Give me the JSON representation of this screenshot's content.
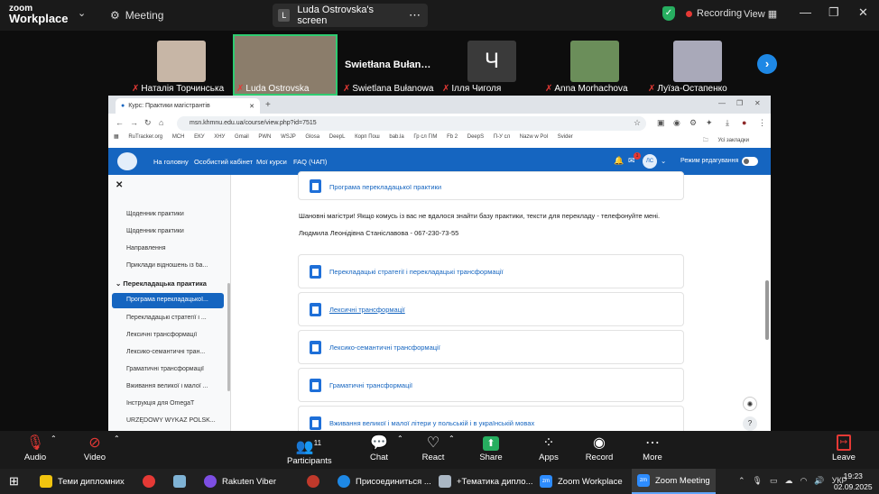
{
  "zoom": {
    "logo_line1": "zoom",
    "logo_line2": "Workplace",
    "meeting_label": "Meeting",
    "screen_initial": "L",
    "screen_label": "Luda Ostrovska's screen",
    "recording_label": "Recording",
    "view_label": "View",
    "colors": {
      "active_border": "#2ecc71",
      "record_dot": "#e53935",
      "shield": "#27ae60"
    }
  },
  "participants": [
    {
      "name": "Наталія Торчинська",
      "thumb_color": "#c7b6a6"
    },
    {
      "name": "Luda Ostrovska",
      "thumb_color": "#8b7d6b",
      "active": true
    },
    {
      "name": "Swietlana Bułanowa",
      "big_label": "Swietłana Bułan…"
    },
    {
      "name": "Ілля Чиголя",
      "initial": "Ч"
    },
    {
      "name": "Anna Morhachova",
      "thumb_color": "#6b8e5a"
    },
    {
      "name": "Луїза-Остапенко",
      "thumb_color": "#a9a9b9"
    }
  ],
  "browser": {
    "tab_title": "Курс: Практики магістрантів",
    "url": "msn.khmnu.edu.ua/course/view.php?id=7515",
    "bookmarks": [
      "RuTracker.org",
      "МСН",
      "ЕКУ",
      "ХНУ",
      "Gmail",
      "PWN",
      "WSJP",
      "Glosa",
      "DeepL",
      "Корп Пош",
      "bab.la",
      "Гр сл ГІМ",
      "Fb 2",
      "DeepS",
      "П-У сл",
      "Nazw w Pol",
      "Svider"
    ],
    "bookmarks_all": "Усі закладки",
    "nav": [
      "На головну",
      "Особистий кабінет",
      "Мої курси",
      "FAQ (ЧАП)"
    ],
    "user_initials": "ЛС",
    "edit_mode_label": "Режим редагування",
    "notification_count": "1"
  },
  "sidebar": {
    "items_top": [
      "Щоденник практики",
      "Щоденник практики",
      "Направлення",
      "Приклади відношень із ба..."
    ],
    "section": "Перекладацька практика",
    "active_item": "Програма перекладацької...",
    "items_bottom": [
      "Перекладацькі стратегії і ...",
      "Лексичні трансформації",
      "Лексико-семантичні тран...",
      "Граматичні трансформації",
      "Вживання великої і малої ...",
      "Інструкція для OmegaT",
      "URZĘDOWY WYKAZ POLSK..."
    ]
  },
  "content": {
    "card_program": "Програма перекладацької практики",
    "notice": "Шановні магістри! Якщо комусь із вас не вдалося знайти базу практики, тексти для перекладу - телефонуйте мені.",
    "contact": "Людмила Леонідівна Станіславова - 067-230-73-55",
    "resources": [
      "Перекладацькі стратегії і перекладацькі трансформації",
      "Лексичні трансформації",
      "Лексико-семантичні трансформації",
      "Граматичні трансформації",
      "Вживання великої і малої літери у польській і в українській мовах"
    ]
  },
  "toolbar": {
    "audio": "Audio",
    "video": "Video",
    "participants": "Participants",
    "participants_count": "11",
    "chat": "Chat",
    "react": "React",
    "share": "Share",
    "apps": "Apps",
    "record": "Record",
    "more": "More",
    "leave": "Leave"
  },
  "taskbar": {
    "items": [
      "Теми дипломних",
      "Rakuten Viber",
      "Присоединиться ...",
      "+Тематика дипло...",
      "Zoom Workplace",
      "Zoom Meeting"
    ],
    "lang": "УКР",
    "time": "19:23",
    "date": "02.09.2025"
  }
}
